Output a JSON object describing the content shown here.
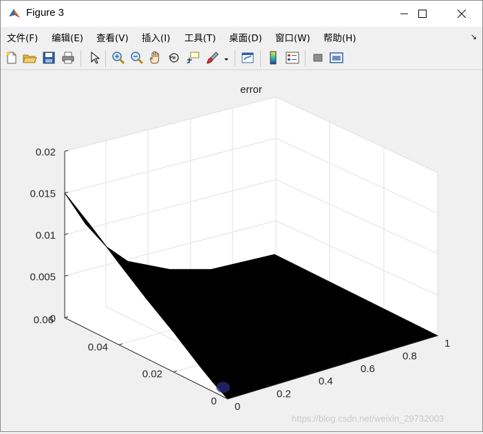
{
  "window": {
    "title": "Figure 3",
    "controls": [
      "minimize",
      "maximize",
      "close"
    ]
  },
  "menu": [
    {
      "label": "文件(F)"
    },
    {
      "label": "编辑(E)"
    },
    {
      "label": "查看(V)"
    },
    {
      "label": "插入(I)"
    },
    {
      "label": "工具(T)"
    },
    {
      "label": "桌面(D)"
    },
    {
      "label": "窗口(W)"
    },
    {
      "label": "帮助(H)"
    }
  ],
  "menu_overflow_icon": "dock-arrow-icon",
  "toolbar": {
    "icons": [
      "new-figure-icon",
      "open-file-icon",
      "save-icon",
      "print-icon",
      "select-arrow-icon",
      "zoom-in-icon",
      "zoom-out-icon",
      "pan-hand-icon",
      "rotate-3d-icon",
      "data-cursor-icon",
      "brush-icon",
      "brush-dropdown-icon",
      "link-plot-icon",
      "colorbar-icon",
      "legend-icon",
      "hide-plot-tools-icon",
      "show-plot-tools-icon"
    ]
  },
  "chart_data": {
    "type": "surface",
    "title": "error",
    "xlabel": "",
    "ylabel": "",
    "zlabel": "",
    "x_ticks": [
      "0",
      "0.2",
      "0.4",
      "0.6",
      "0.8",
      "1"
    ],
    "y_ticks": [
      "0",
      "0.02",
      "0.04",
      "0.06"
    ],
    "z_ticks": [
      "0",
      "0.005",
      "0.01",
      "0.015",
      "0.02"
    ],
    "xlim": [
      0,
      1
    ],
    "ylim": [
      0,
      0.06
    ],
    "zlim": [
      0,
      0.02
    ],
    "grid": true,
    "surface_color": "#000000",
    "edge_profile_x0": {
      "y": [
        0.06,
        0.05,
        0.04,
        0.03,
        0.02,
        0.01,
        0.005,
        0.0
      ],
      "z": [
        0.015,
        0.0125,
        0.0098,
        0.0072,
        0.0048,
        0.0022,
        0.001,
        0.0
      ]
    },
    "edge_profile_ymax": {
      "x": [
        0.0,
        0.1,
        0.2,
        0.3,
        0.5,
        0.7,
        1.0
      ],
      "z": [
        0.015,
        0.0105,
        0.007,
        0.0045,
        0.002,
        0.0005,
        0.0
      ]
    }
  },
  "watermark": "https://blog.csdn.net/weixin_29732003"
}
